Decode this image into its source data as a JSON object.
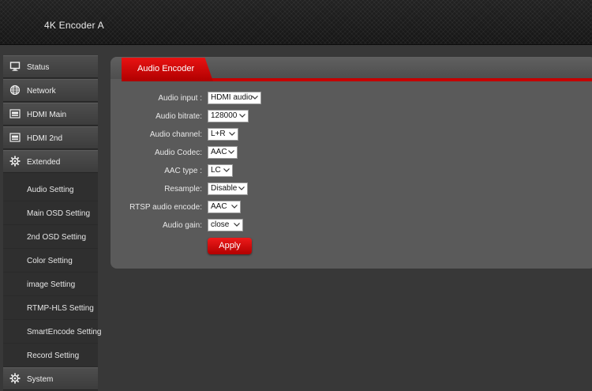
{
  "header": {
    "title": "4K Encoder  A"
  },
  "sidebar": {
    "items": [
      {
        "label": "Status",
        "icon": "monitor-icon"
      },
      {
        "label": "Network",
        "icon": "globe-icon"
      },
      {
        "label": "HDMI Main",
        "icon": "hdmi-icon"
      },
      {
        "label": "HDMI 2nd",
        "icon": "hdmi-icon"
      },
      {
        "label": "Extended",
        "icon": "gear-icon"
      }
    ],
    "subitems": [
      "Audio Setting",
      "Main OSD Setting",
      "2nd OSD Setting",
      "Color Setting",
      "image Setting",
      "RTMP-HLS Setting",
      "SmartEncode Setting",
      "Record Setting"
    ],
    "system": {
      "label": "System",
      "icon": "gear-icon"
    }
  },
  "panel": {
    "tab_label": "Audio Encoder",
    "fields": [
      {
        "label": "Audio input :",
        "value": "HDMI audio"
      },
      {
        "label": "Audio bitrate:",
        "value": "128000"
      },
      {
        "label": "Audio channel:",
        "value": "L+R"
      },
      {
        "label": "Audio Codec:",
        "value": "AAC"
      },
      {
        "label": "AAC type :",
        "value": "LC"
      },
      {
        "label": "Resample:",
        "value": "Disable"
      },
      {
        "label": "RTSP audio encode:",
        "value": "AAC"
      },
      {
        "label": "Audio gain:",
        "value": "close"
      }
    ],
    "apply_label": "Apply"
  },
  "colors": {
    "accent": "#d40000",
    "panel": "#5a5a5a",
    "background": "#383838"
  }
}
